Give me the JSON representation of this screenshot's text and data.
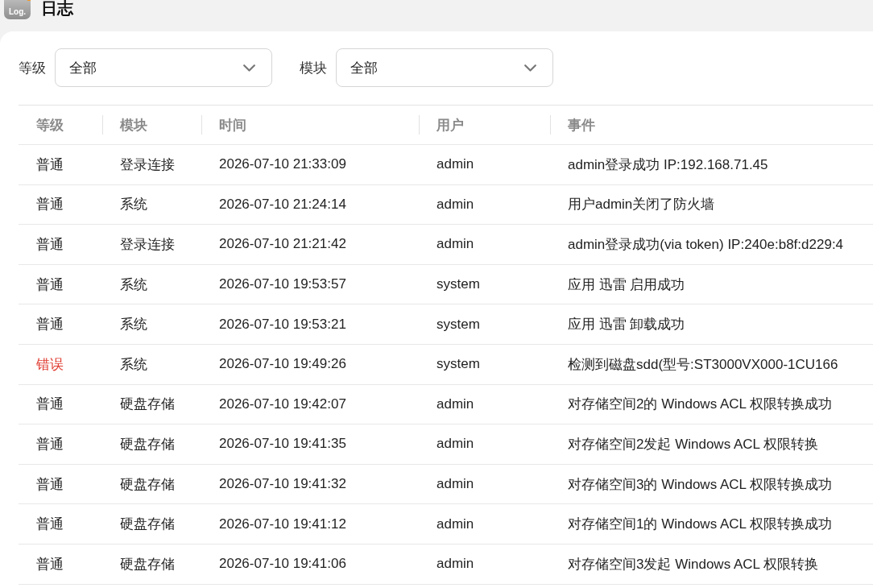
{
  "app": {
    "logo_text": "Log.",
    "title": "日志"
  },
  "filters": [
    {
      "label": "等级",
      "value": "全部"
    },
    {
      "label": "模块",
      "value": "全部"
    }
  ],
  "table": {
    "columns": [
      "等级",
      "模块",
      "时间",
      "用户",
      "事件"
    ],
    "rows": [
      {
        "kind": "normal",
        "level": "普通",
        "module": "登录连接",
        "time": "2026-07-10 21:33:09",
        "user": "admin",
        "event": "admin登录成功 IP:192.168.71.45"
      },
      {
        "kind": "normal",
        "level": "普通",
        "module": "系统",
        "time": "2026-07-10 21:24:14",
        "user": "admin",
        "event": "用户admin关闭了防火墙"
      },
      {
        "kind": "normal",
        "level": "普通",
        "module": "登录连接",
        "time": "2026-07-10 21:21:42",
        "user": "admin",
        "event": "admin登录成功(via token) IP:240e:b8f:d229:4"
      },
      {
        "kind": "normal",
        "level": "普通",
        "module": "系统",
        "time": "2026-07-10 19:53:57",
        "user": "system",
        "event": "应用 迅雷 启用成功"
      },
      {
        "kind": "normal",
        "level": "普通",
        "module": "系统",
        "time": "2026-07-10 19:53:21",
        "user": "system",
        "event": "应用 迅雷 卸载成功"
      },
      {
        "kind": "error",
        "level": "错误",
        "module": "系统",
        "time": "2026-07-10 19:49:26",
        "user": "system",
        "event": "检测到磁盘sdd(型号:ST3000VX000-1CU166"
      },
      {
        "kind": "normal",
        "level": "普通",
        "module": "硬盘存储",
        "time": "2026-07-10 19:42:07",
        "user": "admin",
        "event": "对存储空间2的 Windows ACL 权限转换成功"
      },
      {
        "kind": "normal",
        "level": "普通",
        "module": "硬盘存储",
        "time": "2026-07-10 19:41:35",
        "user": "admin",
        "event": "对存储空间2发起 Windows ACL 权限转换"
      },
      {
        "kind": "normal",
        "level": "普通",
        "module": "硬盘存储",
        "time": "2026-07-10 19:41:32",
        "user": "admin",
        "event": "对存储空间3的 Windows ACL 权限转换成功"
      },
      {
        "kind": "normal",
        "level": "普通",
        "module": "硬盘存储",
        "time": "2026-07-10 19:41:12",
        "user": "admin",
        "event": "对存储空间1的 Windows ACL 权限转换成功"
      },
      {
        "kind": "normal",
        "level": "普通",
        "module": "硬盘存储",
        "time": "2026-07-10 19:41:06",
        "user": "admin",
        "event": "对存储空间3发起 Windows ACL 权限转换"
      }
    ]
  }
}
